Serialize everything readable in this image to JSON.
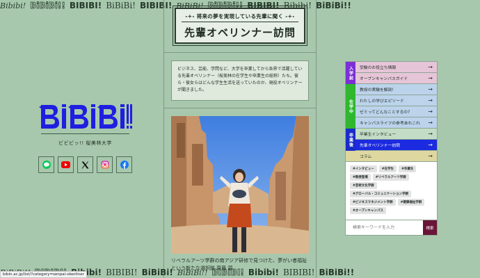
{
  "marquee": {
    "top": [
      "Bibibi!",
      "BiBiBi!!",
      "BIBIBI!",
      "BiBiBi!",
      "BIBIBI!",
      "BiBiBi!",
      "BiBiBi!!",
      "BIBIBI!",
      "Bibibi!",
      "BiBiBi!!"
    ],
    "bottom": [
      "BiBiBi!!",
      "BIBIBI!",
      "Bibibi!",
      "BIBIBI!",
      "BiBiBi!",
      "BiBiBi!!",
      "BIBIBI!",
      "Bibibi!",
      "BIBIBI!",
      "BiBiBi!!"
    ]
  },
  "brand": {
    "name": "ビビビッ!! 桜美林大学"
  },
  "sns": [
    "line-icon",
    "youtube-icon",
    "x-icon",
    "instagram-icon",
    "facebook-icon"
  ],
  "header": {
    "subtitle": "将来の夢を実現している先輩に聞く",
    "title": "先輩オベリンナー訪問"
  },
  "intro": "ビジネス、芸能、学問など、大学を卒業してから各界で活躍している先輩オベリンナー（桜美林の在学生や卒業生の総称）たち。彼ら・彼女らはどんな学生生活を送っていたのか、現役オベリンナーが聞きました。",
  "caption": "リベラルアーツ学群の南アジア研修で見つけた、夢がい者福祉という新たな選択肢 齋藤 碧",
  "nav": {
    "groups": [
      {
        "label": "入学前",
        "color": "#7c2fd6",
        "items": [
          {
            "label": "受験のお役立ち情報",
            "bg": "#e7c5d8"
          },
          {
            "label": "オープンキャンパスガイド",
            "bg": "#e7c5d8"
          }
        ]
      },
      {
        "label": "在学中",
        "color": "#2fb82f",
        "items": [
          {
            "label": "教授の実験を解剖!",
            "bg": "#bcd3ec"
          },
          {
            "label": "わたしの学びエピソード",
            "bg": "#bcd3ec"
          },
          {
            "label": "ゼミってどんなことするの?",
            "bg": "#bcd3ec"
          },
          {
            "label": "キャンパスライフの参考あれこれ",
            "bg": "#bcd3ec"
          }
        ]
      },
      {
        "label": "卒業後",
        "color": "#1a2cc7",
        "items": [
          {
            "label": "卒業生インタビュー",
            "bg": "#c3dcc6"
          },
          {
            "label": "先輩オベリンナー訪問",
            "bg": "#1c2ae0",
            "active": true
          }
        ]
      }
    ],
    "column": {
      "label": "コラム",
      "bg": "#ded7a0"
    },
    "arrow": "→",
    "tags": [
      "#インタビュー",
      "#在学生",
      "#卒業生",
      "#教授登場",
      "#リベラルアーツ学群",
      "#芸術文化学群",
      "#グローバル・コミュニケーション学群",
      "#ビジネスマネジメント学群",
      "#健康福祉学群",
      "#オープンキャンパス"
    ],
    "search": {
      "placeholder": "検索キーワードを入力",
      "button": "検索"
    }
  },
  "status_url": "bibin.ac.jp/list/?category=senpai-oberliner",
  "colors": {
    "background": "#a8c8ad",
    "logo": "#1f1fe0",
    "search_button": "#6a1538"
  }
}
